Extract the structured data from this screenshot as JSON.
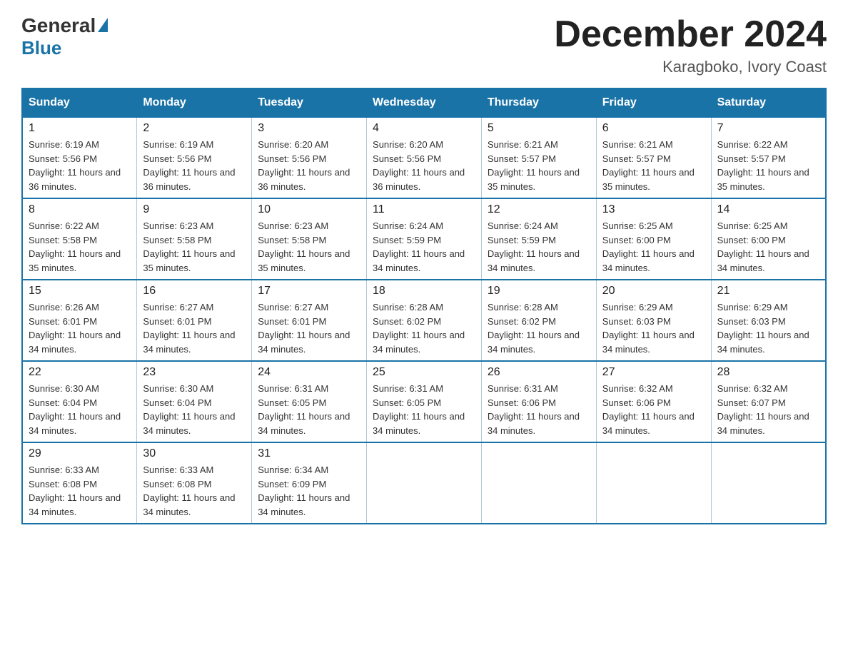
{
  "header": {
    "logo": {
      "general": "General",
      "blue": "Blue"
    },
    "title": "December 2024",
    "location": "Karagboko, Ivory Coast"
  },
  "days_of_week": [
    "Sunday",
    "Monday",
    "Tuesday",
    "Wednesday",
    "Thursday",
    "Friday",
    "Saturday"
  ],
  "weeks": [
    [
      {
        "day": "1",
        "sunrise": "6:19 AM",
        "sunset": "5:56 PM",
        "daylight": "11 hours and 36 minutes."
      },
      {
        "day": "2",
        "sunrise": "6:19 AM",
        "sunset": "5:56 PM",
        "daylight": "11 hours and 36 minutes."
      },
      {
        "day": "3",
        "sunrise": "6:20 AM",
        "sunset": "5:56 PM",
        "daylight": "11 hours and 36 minutes."
      },
      {
        "day": "4",
        "sunrise": "6:20 AM",
        "sunset": "5:56 PM",
        "daylight": "11 hours and 36 minutes."
      },
      {
        "day": "5",
        "sunrise": "6:21 AM",
        "sunset": "5:57 PM",
        "daylight": "11 hours and 35 minutes."
      },
      {
        "day": "6",
        "sunrise": "6:21 AM",
        "sunset": "5:57 PM",
        "daylight": "11 hours and 35 minutes."
      },
      {
        "day": "7",
        "sunrise": "6:22 AM",
        "sunset": "5:57 PM",
        "daylight": "11 hours and 35 minutes."
      }
    ],
    [
      {
        "day": "8",
        "sunrise": "6:22 AM",
        "sunset": "5:58 PM",
        "daylight": "11 hours and 35 minutes."
      },
      {
        "day": "9",
        "sunrise": "6:23 AM",
        "sunset": "5:58 PM",
        "daylight": "11 hours and 35 minutes."
      },
      {
        "day": "10",
        "sunrise": "6:23 AM",
        "sunset": "5:58 PM",
        "daylight": "11 hours and 35 minutes."
      },
      {
        "day": "11",
        "sunrise": "6:24 AM",
        "sunset": "5:59 PM",
        "daylight": "11 hours and 34 minutes."
      },
      {
        "day": "12",
        "sunrise": "6:24 AM",
        "sunset": "5:59 PM",
        "daylight": "11 hours and 34 minutes."
      },
      {
        "day": "13",
        "sunrise": "6:25 AM",
        "sunset": "6:00 PM",
        "daylight": "11 hours and 34 minutes."
      },
      {
        "day": "14",
        "sunrise": "6:25 AM",
        "sunset": "6:00 PM",
        "daylight": "11 hours and 34 minutes."
      }
    ],
    [
      {
        "day": "15",
        "sunrise": "6:26 AM",
        "sunset": "6:01 PM",
        "daylight": "11 hours and 34 minutes."
      },
      {
        "day": "16",
        "sunrise": "6:27 AM",
        "sunset": "6:01 PM",
        "daylight": "11 hours and 34 minutes."
      },
      {
        "day": "17",
        "sunrise": "6:27 AM",
        "sunset": "6:01 PM",
        "daylight": "11 hours and 34 minutes."
      },
      {
        "day": "18",
        "sunrise": "6:28 AM",
        "sunset": "6:02 PM",
        "daylight": "11 hours and 34 minutes."
      },
      {
        "day": "19",
        "sunrise": "6:28 AM",
        "sunset": "6:02 PM",
        "daylight": "11 hours and 34 minutes."
      },
      {
        "day": "20",
        "sunrise": "6:29 AM",
        "sunset": "6:03 PM",
        "daylight": "11 hours and 34 minutes."
      },
      {
        "day": "21",
        "sunrise": "6:29 AM",
        "sunset": "6:03 PM",
        "daylight": "11 hours and 34 minutes."
      }
    ],
    [
      {
        "day": "22",
        "sunrise": "6:30 AM",
        "sunset": "6:04 PM",
        "daylight": "11 hours and 34 minutes."
      },
      {
        "day": "23",
        "sunrise": "6:30 AM",
        "sunset": "6:04 PM",
        "daylight": "11 hours and 34 minutes."
      },
      {
        "day": "24",
        "sunrise": "6:31 AM",
        "sunset": "6:05 PM",
        "daylight": "11 hours and 34 minutes."
      },
      {
        "day": "25",
        "sunrise": "6:31 AM",
        "sunset": "6:05 PM",
        "daylight": "11 hours and 34 minutes."
      },
      {
        "day": "26",
        "sunrise": "6:31 AM",
        "sunset": "6:06 PM",
        "daylight": "11 hours and 34 minutes."
      },
      {
        "day": "27",
        "sunrise": "6:32 AM",
        "sunset": "6:06 PM",
        "daylight": "11 hours and 34 minutes."
      },
      {
        "day": "28",
        "sunrise": "6:32 AM",
        "sunset": "6:07 PM",
        "daylight": "11 hours and 34 minutes."
      }
    ],
    [
      {
        "day": "29",
        "sunrise": "6:33 AM",
        "sunset": "6:08 PM",
        "daylight": "11 hours and 34 minutes."
      },
      {
        "day": "30",
        "sunrise": "6:33 AM",
        "sunset": "6:08 PM",
        "daylight": "11 hours and 34 minutes."
      },
      {
        "day": "31",
        "sunrise": "6:34 AM",
        "sunset": "6:09 PM",
        "daylight": "11 hours and 34 minutes."
      },
      null,
      null,
      null,
      null
    ]
  ]
}
